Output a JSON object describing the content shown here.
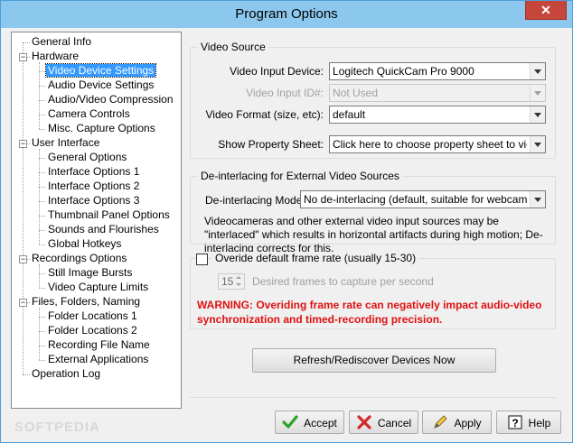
{
  "window": {
    "title": "Program Options",
    "close_glyph": "✕"
  },
  "tree": {
    "items": [
      {
        "label": "General Info",
        "level": 0,
        "expander": ""
      },
      {
        "label": "Hardware",
        "level": 0,
        "expander": "−"
      },
      {
        "label": "Video Device Settings",
        "level": 1,
        "expander": "",
        "selected": true
      },
      {
        "label": "Audio Device Settings",
        "level": 1,
        "expander": ""
      },
      {
        "label": "Audio/Video Compression",
        "level": 1,
        "expander": ""
      },
      {
        "label": "Camera Controls",
        "level": 1,
        "expander": ""
      },
      {
        "label": "Misc. Capture Options",
        "level": 1,
        "expander": ""
      },
      {
        "label": "User Interface",
        "level": 0,
        "expander": "−"
      },
      {
        "label": "General Options",
        "level": 1,
        "expander": ""
      },
      {
        "label": "Interface Options 1",
        "level": 1,
        "expander": ""
      },
      {
        "label": "Interface Options 2",
        "level": 1,
        "expander": ""
      },
      {
        "label": "Interface Options 3",
        "level": 1,
        "expander": ""
      },
      {
        "label": "Thumbnail Panel Options",
        "level": 1,
        "expander": ""
      },
      {
        "label": "Sounds and Flourishes",
        "level": 1,
        "expander": ""
      },
      {
        "label": "Global Hotkeys",
        "level": 1,
        "expander": ""
      },
      {
        "label": "Recordings Options",
        "level": 0,
        "expander": "−"
      },
      {
        "label": "Still Image Bursts",
        "level": 1,
        "expander": ""
      },
      {
        "label": "Video Capture Limits",
        "level": 1,
        "expander": ""
      },
      {
        "label": "Files, Folders, Naming",
        "level": 0,
        "expander": "−"
      },
      {
        "label": "Folder Locations 1",
        "level": 1,
        "expander": ""
      },
      {
        "label": "Folder Locations 2",
        "level": 1,
        "expander": ""
      },
      {
        "label": "Recording File Name",
        "level": 1,
        "expander": ""
      },
      {
        "label": "External Applications",
        "level": 1,
        "expander": ""
      },
      {
        "label": "Operation Log",
        "level": 0,
        "expander": ""
      }
    ]
  },
  "video_source": {
    "group_label": "Video Source",
    "input_device_label": "Video Input Device:",
    "input_device_value": "Logitech QuickCam Pro 9000",
    "input_id_label": "Video Input ID#:",
    "input_id_value": "Not Used",
    "format_label": "Video Format (size, etc):",
    "format_value": "default",
    "property_label": "Show Property Sheet:",
    "property_value": "Click here to choose property sheet to view..."
  },
  "deinterlace": {
    "group_label": "De-interlacing for External Video Sources",
    "mode_label": "De-interlacing Mode:",
    "mode_value": "No de-interlacing (default, suitable for webcams)",
    "description": "Videocameras and other external video input sources may be \"interlaced\" which results in horizontal artifacts during high motion; De-interlacing corrects for this."
  },
  "framerate": {
    "checkbox_label": "Overide default frame rate (usually 15-30)",
    "checked": false,
    "spin_value": "15",
    "desired_label": "Desired frames to capture per second",
    "warning": "WARNING: Overiding frame rate can negatively impact audio-video synchronization and timed-recording precision."
  },
  "refresh_button": "Refresh/Rediscover Devices Now",
  "footer": {
    "accept": "Accept",
    "cancel": "Cancel",
    "apply": "Apply",
    "help": "Help"
  },
  "watermark": "SOFTPEDIA",
  "colors": {
    "selection": "#3399ff",
    "warning": "#e01010",
    "accept_icon": "#2aa32a",
    "cancel_icon": "#d22a2a"
  }
}
